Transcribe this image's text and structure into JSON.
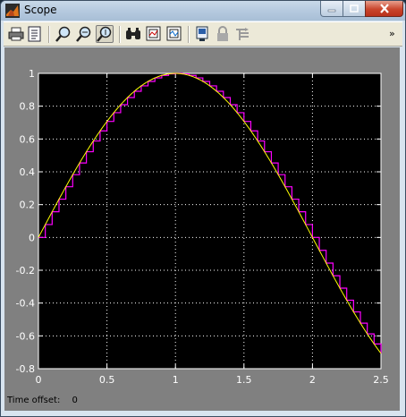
{
  "window": {
    "title": "Scope"
  },
  "toolbar": {
    "buttons": [
      {
        "name": "print-icon"
      },
      {
        "name": "parameters-icon"
      },
      {
        "name": "zoom-in-icon"
      },
      {
        "name": "zoom-x-icon"
      },
      {
        "name": "zoom-y-icon"
      },
      {
        "name": "autoscale-icon"
      },
      {
        "name": "save-axes-icon"
      },
      {
        "name": "restore-axes-icon"
      },
      {
        "name": "floating-scope-icon"
      },
      {
        "name": "lock-icon"
      },
      {
        "name": "signal-selection-icon"
      }
    ],
    "overflow": "»"
  },
  "footer": {
    "time_offset_label": "Time offset:",
    "time_offset_value": "0"
  },
  "colors": {
    "background": "#808080",
    "axes": "#000000",
    "signal_continuous": "#ffff00",
    "signal_discrete": "#ff00ff",
    "grid": "#ffffff"
  },
  "chart_data": {
    "type": "line",
    "xlim": [
      0,
      2.5
    ],
    "ylim": [
      -0.8,
      1
    ],
    "xticks": [
      "0",
      "0.5",
      "1",
      "1.5",
      "2",
      "2.5"
    ],
    "yticks": [
      "-0.8",
      "-0.6",
      "-0.4",
      "-0.2",
      "0",
      "0.2",
      "0.4",
      "0.6",
      "0.8",
      "1"
    ],
    "grid": true,
    "series": [
      {
        "style": "line",
        "color": "#ffff00",
        "function": "sin(pi*x/2)",
        "x_range": [
          0,
          2.5
        ]
      },
      {
        "style": "step",
        "color": "#ff00ff",
        "function": "sin(pi*x/2)",
        "sample_time": 0.05,
        "x_range": [
          0,
          2.5
        ]
      }
    ]
  }
}
